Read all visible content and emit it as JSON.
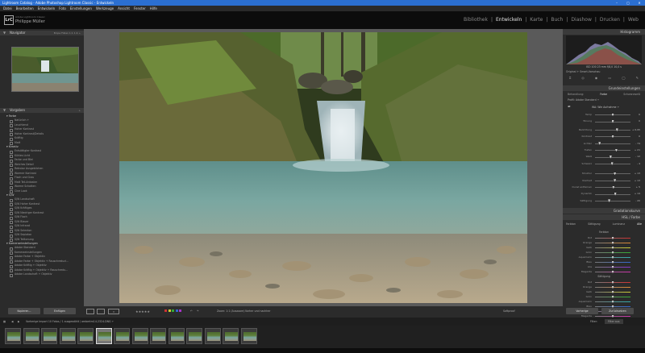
{
  "window": {
    "title": "Lightroom Catalog - Adobe Photoshop Lightroom Classic - Entwickeln",
    "controls": [
      "–",
      "▢",
      "✕"
    ]
  },
  "menu": [
    "Datei",
    "Bearbeiten",
    "Entwickeln",
    "Foto",
    "Einstellungen",
    "Werkzeuge",
    "Ansicht",
    "Fenster",
    "Hilfe"
  ],
  "identity": {
    "small": "Adobe Lightroom Classic",
    "name": "Philippe Müller",
    "logo": "LrC"
  },
  "modules": [
    "Bibliothek",
    "Entwickeln",
    "Karte",
    "Buch",
    "Diashow",
    "Drucken",
    "Web"
  ],
  "active_module": "Entwickeln",
  "left_panel": {
    "navigator": {
      "title": "Navigator",
      "zoom": "Einpa   Füllen   1:1   1:4 ÷"
    },
    "presets": {
      "title": "Vorgaben",
      "groups": [
        {
          "name": "Farbe",
          "items": [
            "Natürlich +",
            "Leuchtend",
            "Hoher Kontrast",
            "Hoher Kontrast/Details",
            "Kräftig",
            "Matt"
          ]
        },
        {
          "name": "Kreativ",
          "items": [
            "Entsättigter Kontrast",
            "Kühles Licht",
            "Farbe und Blei",
            "Weiches Detail",
            "Retrolaz Ausgeblichen",
            "Warmer Kontrast",
            "Flach und Grau",
            "Matt Teil-Antaster",
            "Warme Schatten",
            "Cine Look"
          ]
        },
        {
          "name": "S/W",
          "items": [
            "S/W Landschaft",
            "S/W Hoher Kontrast",
            "S/W Kräftiges",
            "S/W Niedriger Kontrast",
            "S/W Flach",
            "S/W Blauer",
            "S/W Infrarot",
            "S/W Selenton",
            "S/W Sepiaton",
            "S/W Teiltonung"
          ]
        },
        {
          "name": "Kameraeinstellungen",
          "items": [
            "Adobe Standard",
            "Kameraeinstellungen",
            "Adobe Farbe + Objektiv",
            "Adobe Farbe + Objektiv + Rauschreduzi...",
            "Adobe Kräftig + Objektiv",
            "Adobe Kräftig + Objektiv + Rauschredu...",
            "Adobe Landschaft + Objektiv"
          ]
        }
      ]
    },
    "buttons": {
      "copy": "Kopieren...",
      "paste": "Einfügen"
    }
  },
  "toolbar": {
    "soft_proof": "Softproof",
    "zoom": "Zoom: 1:1 (Auszoom)",
    "before_after": "Vorher und nachher",
    "flags": "★★★★★"
  },
  "right_panel": {
    "histogram": {
      "title": "Histogramm",
      "readout": "ISO 100   23 mm   f/8,0   10,0 s",
      "original": "Original + Smart-Vorschau"
    },
    "basic": {
      "title": "Grundeinstellungen",
      "treatment_options": [
        "Behandlung:",
        "Farbe",
        "Schwarzweiß"
      ],
      "profile": "Profil:  Adobe Standard ÷",
      "wb": "WA: Wie Aufnahme ÷",
      "sliders": [
        {
          "label": "Temp",
          "value": "0",
          "pos": 0.5
        },
        {
          "label": "Tönung",
          "value": "0",
          "pos": 0.5
        },
        {
          "label": "Belichtung",
          "value": "+ 0,95",
          "pos": 0.62
        },
        {
          "label": "Kontrast",
          "value": "0",
          "pos": 0.5
        },
        {
          "label": "Lichter",
          "value": "- 74",
          "pos": 0.13
        },
        {
          "label": "Tiefen",
          "value": "+ 21",
          "pos": 0.6
        },
        {
          "label": "Weiß",
          "value": "- 12",
          "pos": 0.44
        },
        {
          "label": "Schwarz",
          "value": "- 4",
          "pos": 0.48
        },
        {
          "label": "Struktur",
          "value": "+ 13",
          "pos": 0.56
        },
        {
          "label": "Klarheit",
          "value": "+ 13",
          "pos": 0.56
        },
        {
          "label": "Dunst entfernen",
          "value": "+ 5",
          "pos": 0.52
        },
        {
          "label": "Dynamik",
          "value": "+ 14",
          "pos": 0.57
        },
        {
          "label": "Sättigung",
          "value": "- 20",
          "pos": 0.4
        }
      ],
      "tone_label": "Ton",
      "auto": "Auto",
      "presence": "Präsenz"
    },
    "tone_curve": {
      "title": "Gradationskurve"
    },
    "hsl": {
      "title": "HSL / Farbe",
      "tabs": [
        "Farbton",
        "Sättigung",
        "Luminanz",
        "Alle"
      ],
      "hue": "Farbton",
      "sat": "Sättigung",
      "colors": [
        "Rot",
        "Orange",
        "Gelb",
        "Grün",
        "Aquamarin",
        "Blau",
        "Lila",
        "Magenta"
      ]
    },
    "buttons": {
      "previous": "Vorherige",
      "reset": "Zurücksetzen"
    }
  },
  "filmbar": {
    "info": "Vorherige Import   10 Fotos / 1 ausgewählt /  ambertm14-2324.DNG ÷",
    "filter": "Filter:",
    "filter_value": "Filter aus"
  },
  "filmstrip": {
    "count": 14,
    "selected_index": 5
  }
}
